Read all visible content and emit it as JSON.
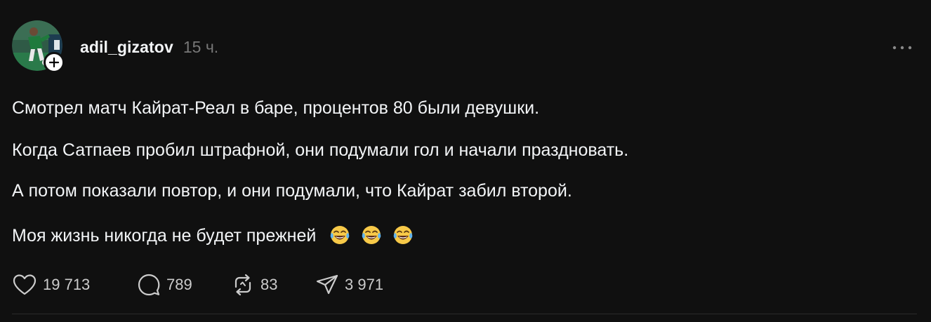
{
  "post": {
    "username": "adil_gizatov",
    "time": "15 ч.",
    "avatar_icon": "avatar-photo-footballer",
    "follow_icon": "plus-icon",
    "more_icon": "more-horizontal-icon",
    "paragraphs": [
      "Смотрел матч Кайрат-Реал в баре, процентов 80 были девушки.",
      "Когда Сатпаев пробил штрафной, они подумали гол и начали праздновать.",
      "А потом показали повтор, и они подумали, что Кайрат забил второй.",
      "Моя жизнь никогда не будет прежней"
    ],
    "emoji": [
      "😂",
      "😂",
      "😂"
    ]
  },
  "actions": {
    "likes": "19 713",
    "comments": "789",
    "reposts": "83",
    "shares": "3 971"
  },
  "colors": {
    "background": "#101010",
    "text": "#f3f5f7",
    "muted": "#777777",
    "divider": "#2a2a2a"
  }
}
